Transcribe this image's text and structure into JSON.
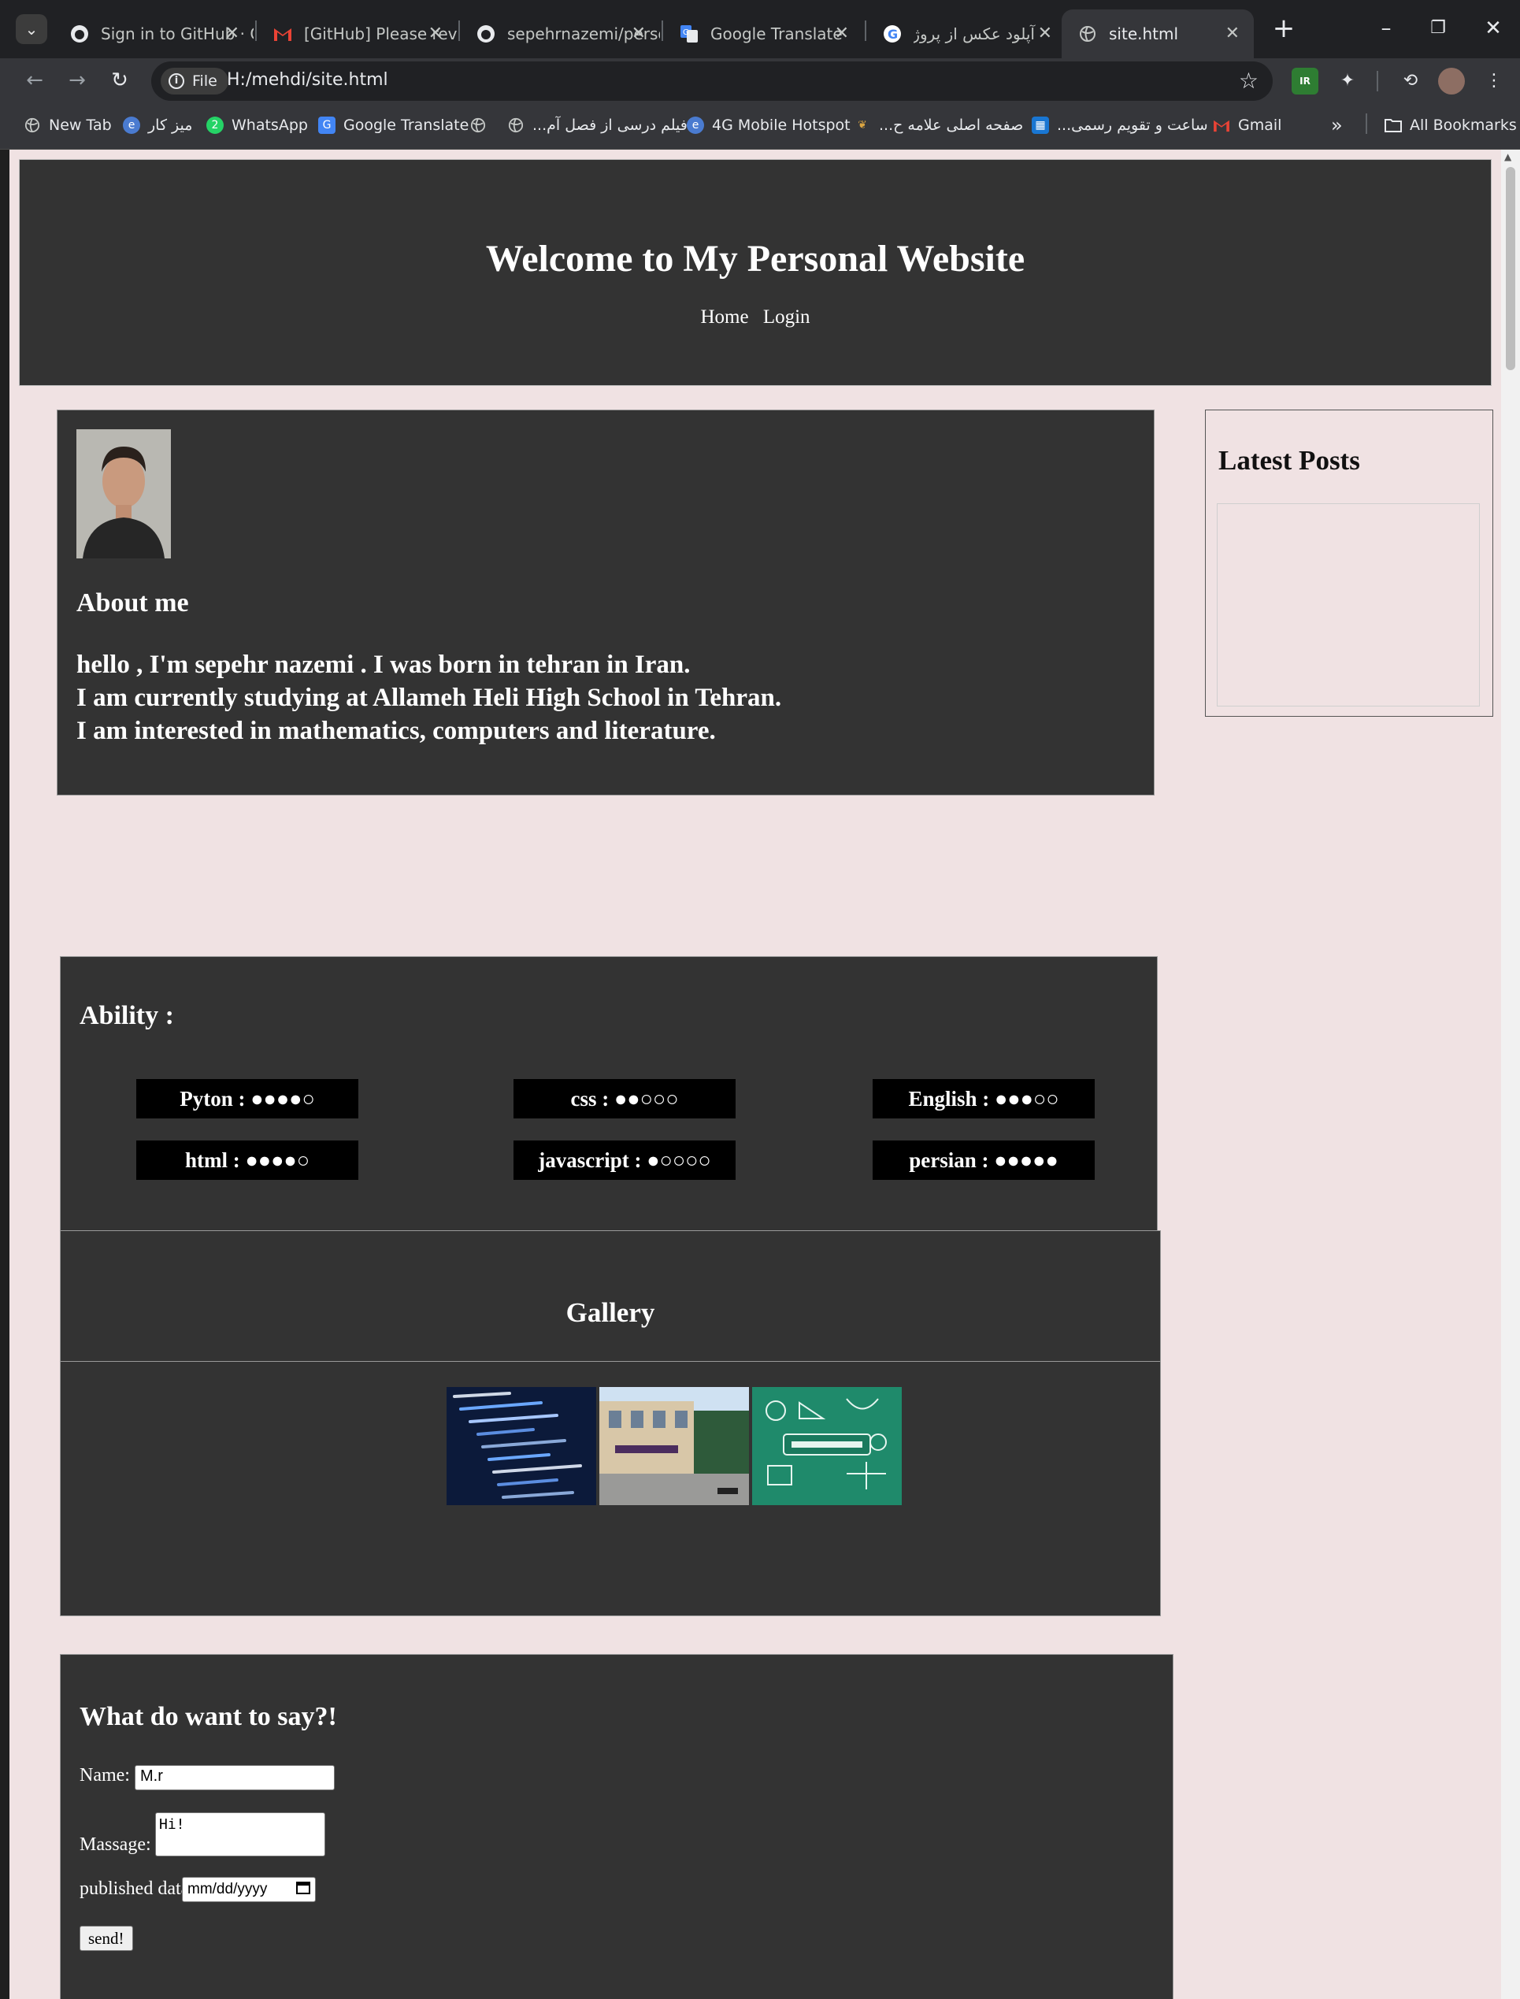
{
  "browser": {
    "tabs": [
      {
        "title": "Sign in to GitHub · GitHub",
        "icon": "github-icon"
      },
      {
        "title": "[GitHub] Please review",
        "icon": "gmail-icon"
      },
      {
        "title": "sepehrnazemi/personal",
        "icon": "github-icon"
      },
      {
        "title": "Google Translate",
        "icon": "google-translate-icon"
      },
      {
        "title": "آپلود عکس از پروژه",
        "icon": "google-icon"
      },
      {
        "title": "site.html",
        "icon": "globe-icon",
        "active": true
      }
    ],
    "site_info_label": "File",
    "url": "H:/mehdi/site.html",
    "bookmarks": [
      {
        "label": "New Tab",
        "icon": "globe-icon"
      },
      {
        "label": "میز کار",
        "icon": "edu-icon"
      },
      {
        "label": "WhatsApp",
        "icon": "whatsapp-icon",
        "badge": "2"
      },
      {
        "label": "Google Translate",
        "icon": "google-translate-icon"
      },
      {
        "label": "",
        "icon": "globe-icon"
      },
      {
        "label": "فیلم درسی از فصل آم...",
        "icon": "globe-icon"
      },
      {
        "label": "4G Mobile Hotspot",
        "icon": "edu-icon"
      },
      {
        "label": "صفحه اصلی علامه ح...",
        "icon": "school-icon"
      },
      {
        "label": "ساعت و تقویم رسمی...",
        "icon": "calendar-icon"
      },
      {
        "label": "Gmail",
        "icon": "gmail-icon"
      }
    ],
    "more_bookmarks": "»",
    "all_bookmarks": "All Bookmarks"
  },
  "page": {
    "title": "Welcome to My Personal Website",
    "nav": [
      "Home",
      "Login"
    ],
    "about": {
      "heading": "About me",
      "lines": [
        "hello , I'm sepehr nazemi . I was born in tehran in Iran.",
        "I am currently studying at Allameh Heli High School in Tehran.",
        "I am interested in mathematics, computers and literature."
      ]
    },
    "latest_posts": {
      "heading": "Latest Posts"
    },
    "ability": {
      "heading": "Ability :",
      "skills": [
        {
          "label": "Pyton : ●●●●○",
          "name": "Pyton",
          "level": 4,
          "max": 5
        },
        {
          "label": "css : ●●○○○",
          "name": "css",
          "level": 2,
          "max": 5
        },
        {
          "label": "English : ●●●○○",
          "name": "English",
          "level": 3,
          "max": 5
        },
        {
          "label": "html : ●●●●○",
          "name": "html",
          "level": 4,
          "max": 5
        },
        {
          "label": "javascript : ●○○○○",
          "name": "javascript",
          "level": 1,
          "max": 5
        },
        {
          "label": "persian : ●●●●●",
          "name": "persian",
          "level": 5,
          "max": 5
        }
      ]
    },
    "gallery": {
      "heading": "Gallery",
      "images": [
        "code-screenshot-image",
        "school-building-image",
        "math-chalkboard-image"
      ]
    },
    "contact": {
      "heading": "What do want to say?!",
      "name_label": "Name:",
      "name_value": "M.r",
      "message_label": "Massage:",
      "message_value": "Hi!",
      "date_label": "published data:",
      "date_placeholder": "mm/dd/yyyy",
      "send_label": "send!"
    }
  },
  "colors": {
    "page_bg": "#f0e2e3",
    "panel_bg": "#333333",
    "skill_bg": "#000000",
    "chrome_bg": "#202124"
  }
}
